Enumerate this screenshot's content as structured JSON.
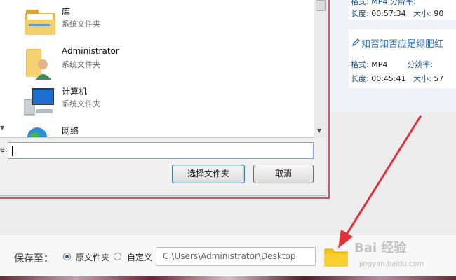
{
  "file_list": {
    "items": [
      {
        "name": "库",
        "type": "系统文件夹",
        "icon": "library-folder-icon"
      },
      {
        "name": "Administrator",
        "type": "系统文件夹",
        "icon": "user-folder-icon"
      },
      {
        "name": "计算机",
        "type": "系统文件夹",
        "icon": "computer-icon"
      },
      {
        "name": "网络",
        "type": "",
        "icon": "network-globe-icon"
      }
    ]
  },
  "dialog": {
    "folder_label": "e:",
    "folder_value": "",
    "select_button": "选择文件夹",
    "cancel_button": "取消"
  },
  "video_cards": [
    {
      "length_label": "长度:",
      "length": "00:57:34",
      "size_label": "大小:",
      "size": "90",
      "format_row_partial": "格式:  MP4      分辨率:"
    },
    {
      "title": "知否知否应是绿肥红",
      "format_label": "格式:",
      "format": "MP4",
      "resolution_label": "分辨率:",
      "length_label": "长度:",
      "length": "00:45:41",
      "size_label": "大小:",
      "size": "57"
    }
  ],
  "save_bar": {
    "label": "保存至：",
    "option_original": "原文件夹",
    "option_custom": "自定义",
    "selected": "原文件夹",
    "path": "C:\\Users\\Administrator\\Desktop",
    "folder_icon": "folder-icon"
  },
  "watermark": {
    "text": "Bai 经验",
    "sub": "jingyan.baidu.com"
  },
  "colors": {
    "accent_blue": "#2d72c4",
    "arrow_red": "#e0303a",
    "folder_yellow": "#f5c518"
  }
}
